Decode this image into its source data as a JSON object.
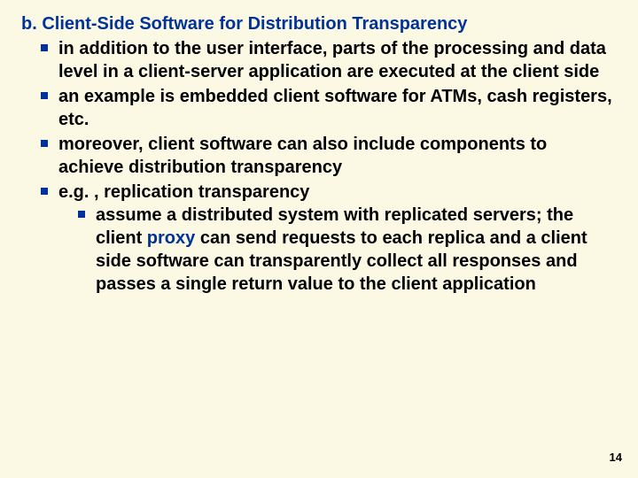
{
  "heading": "b. Client-Side Software for Distribution Transparency",
  "bullets": {
    "b1": "in addition to the user interface, parts of the processing and data level in a client-server application are executed at the client side",
    "b2": "an example is embedded client software for ATMs, cash registers, etc.",
    "b3": "moreover, client software can also include components to achieve distribution transparency",
    "b4": "e.g. , replication transparency",
    "b5_pre": "assume a distributed system with replicated servers; the client ",
    "b5_link": "proxy",
    "b5_post": " can send requests to each replica and a client side software can transparently collect all responses and passes a single return value to the client application"
  },
  "page_number": "14"
}
